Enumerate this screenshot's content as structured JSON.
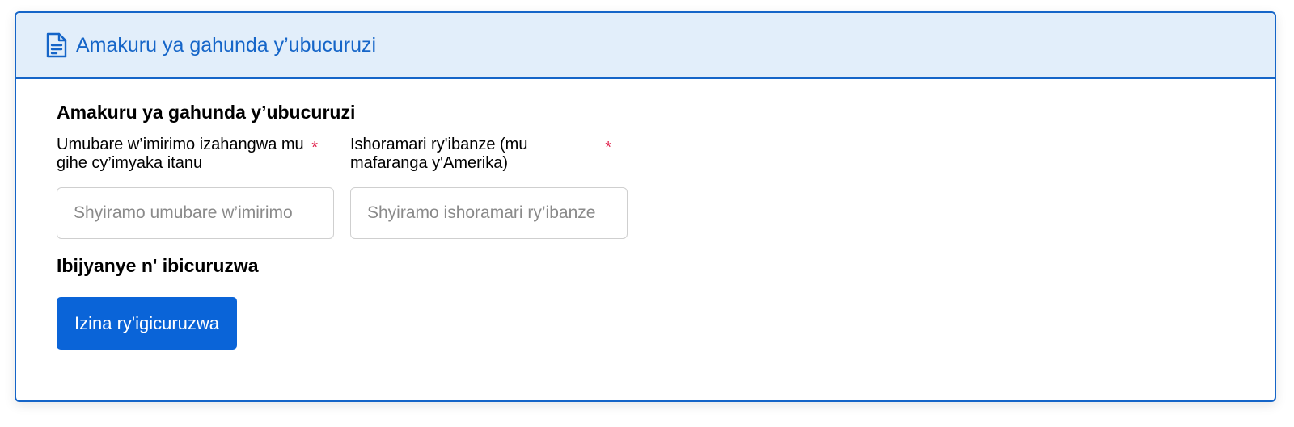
{
  "panel": {
    "header_title": "Amakuru ya gahunda y’ubucuruzi",
    "header_icon": "document-icon",
    "accent_color": "#1565c8",
    "header_bg_color": "#e2eefa"
  },
  "form": {
    "section_title": "Amakuru ya gahunda y’ubucuruzi",
    "fields": [
      {
        "label": "Umubare w’imirimo izahangwa mu gihe cy’imyaka itanu",
        "required_marker": "*",
        "placeholder": "Shyiramo umubare w’imirimo",
        "value": ""
      },
      {
        "label": "Ishoramari ry'ibanze (mu mafaranga y'Amerika)",
        "required_marker": "*",
        "placeholder": "Shyiramo ishoramari ry’ibanze",
        "value": ""
      }
    ],
    "products_title": "Ibijyanye n' ibicuruzwa",
    "add_product_button": "Izina ry'igicuruzwa",
    "button_color": "#0a64d8",
    "required_color": "#e0204a"
  }
}
